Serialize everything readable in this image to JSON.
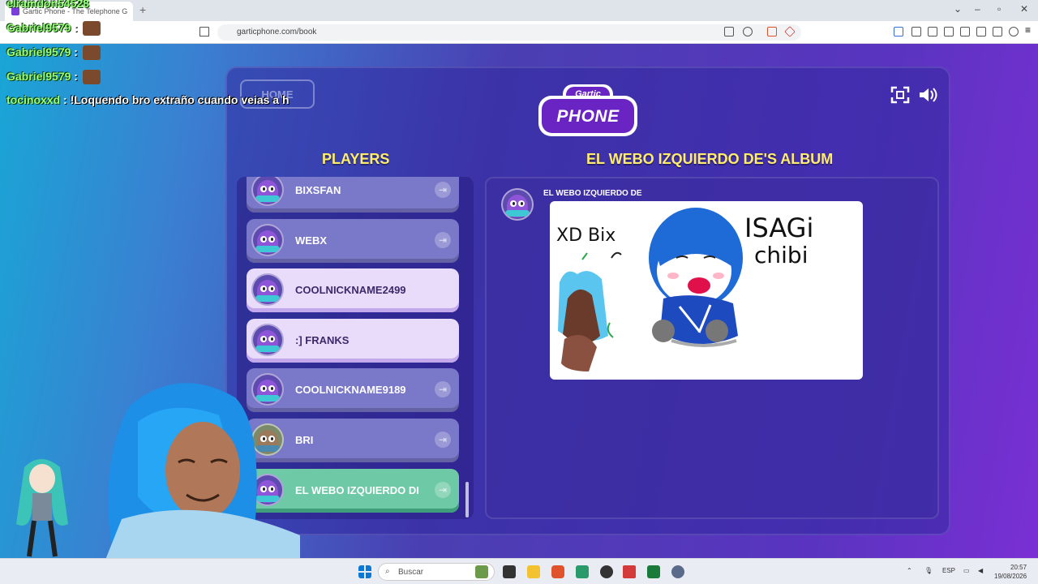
{
  "browser": {
    "tab_title": "Gartic Phone - The Telephone G",
    "url": "garticphone.com/book",
    "new_tab": "+"
  },
  "game": {
    "home_label": "HOME",
    "logo_top": "Gartic",
    "logo_word": "PHONE",
    "players_heading": "PLAYERS",
    "album_heading": "EL WEBO IZQUIERDO DE'S ALBUM",
    "album_author": "EL WEBO IZQUIERDO DE",
    "players": [
      {
        "name": "BIXSFAN",
        "state": "normal"
      },
      {
        "name": "WEBX",
        "state": "normal"
      },
      {
        "name": "COOLNICKNAME2499",
        "state": "me"
      },
      {
        "name": ":] FRANKS",
        "state": "me"
      },
      {
        "name": "COOLNICKNAME9189",
        "state": "normal"
      },
      {
        "name": "BRI",
        "state": "normal"
      },
      {
        "name": "EL WEBO IZQUIERDO DI",
        "state": "active"
      }
    ],
    "drawing": {
      "left_text": "XD Bix",
      "right_text_1": "ISAGi",
      "right_text_2": "chibi"
    }
  },
  "chat": [
    {
      "user": "elramdon54528",
      "message": ""
    },
    {
      "user": "Gabriel9579",
      "message": ""
    },
    {
      "user": "Gabriel9579",
      "message": ""
    },
    {
      "user": "Gabriel9579",
      "message": ""
    },
    {
      "user": "tocinoxxd",
      "message": "!Loquendo bro extraño cuando veias a h"
    }
  ],
  "taskbar": {
    "search_placeholder": "Buscar",
    "lang": "ESP",
    "time": "20:57",
    "date": "19/08/2026"
  },
  "colors": {
    "heading": "#ffec6b",
    "row_normal": "#7a78c9",
    "row_me": "#e9dcfb",
    "row_active": "#6ec9a6",
    "chat_user": "#9cff7a"
  },
  "icons": [
    "fullscreen-icon",
    "volume-icon",
    "kick-icon",
    "windows-start-icon",
    "search-icon"
  ]
}
